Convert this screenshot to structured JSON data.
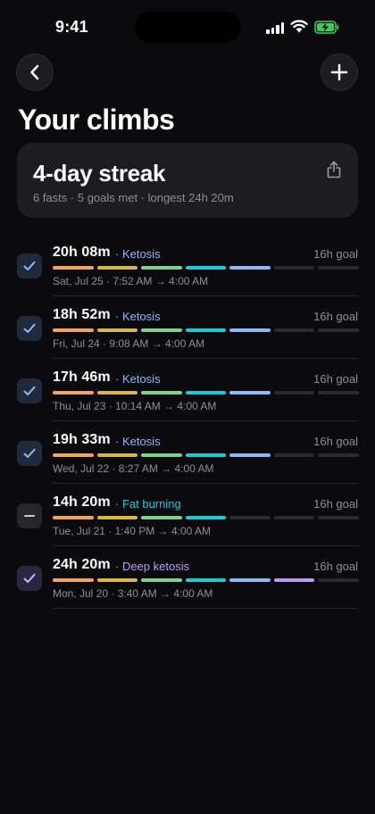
{
  "status": {
    "time": "9:41"
  },
  "header": {
    "title": "Your climbs"
  },
  "streak": {
    "title": "4-day streak",
    "subtitle": "6 fasts · 5 goals met · longest 24h 20m"
  },
  "colors": {
    "background": "#0b0b0e",
    "card": "#1c1c21",
    "segments": [
      "#f4a261",
      "#d9b54a",
      "#7fcf8e",
      "#22c7d6",
      "#8db8f5",
      "#b89cf4"
    ],
    "ketosis": "#8db8f5",
    "fat_burning": "#22c7d6",
    "deep_ketosis": "#b89cf4"
  },
  "fasts": [
    {
      "duration": "20h 08m",
      "phase": "· Ketosis",
      "phase_color": "#8db8f5",
      "goal": "16h goal",
      "detail": "Sat, Jul 25 · 7:52 AM → 4:00 AM",
      "status": "met",
      "segments_filled": 5
    },
    {
      "duration": "18h 52m",
      "phase": "· Ketosis",
      "phase_color": "#8db8f5",
      "goal": "16h goal",
      "detail": "Fri, Jul 24 · 9:08 AM → 4:00 AM",
      "status": "met",
      "segments_filled": 5
    },
    {
      "duration": "17h 46m",
      "phase": "· Ketosis",
      "phase_color": "#8db8f5",
      "goal": "16h goal",
      "detail": "Thu, Jul 23 · 10:14 AM → 4:00 AM",
      "status": "met",
      "segments_filled": 5
    },
    {
      "duration": "19h 33m",
      "phase": "· Ketosis",
      "phase_color": "#8db8f5",
      "goal": "16h goal",
      "detail": "Wed, Jul 22 · 8:27 AM → 4:00 AM",
      "status": "met",
      "segments_filled": 5
    },
    {
      "duration": "14h 20m",
      "phase": "· Fat burning",
      "phase_color": "#22c7d6",
      "goal": "16h goal",
      "detail": "Tue, Jul 21 · 1:40 PM → 4:00 AM",
      "status": "missed",
      "segments_filled": 4
    },
    {
      "duration": "24h 20m",
      "phase": "· Deep ketosis",
      "phase_color": "#b89cf4",
      "goal": "16h goal",
      "detail": "Mon, Jul 20 · 3:40 AM → 4:00 AM",
      "status": "met-deep",
      "segments_filled": 6
    }
  ]
}
